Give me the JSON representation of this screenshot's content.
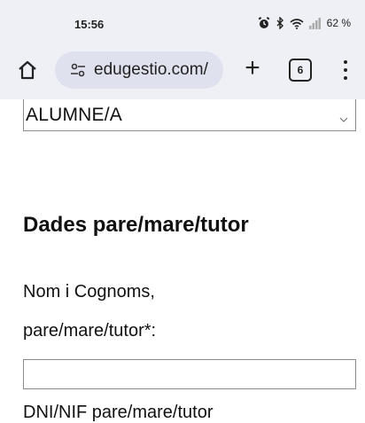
{
  "status_bar": {
    "time": "15:56",
    "battery": "62 %",
    "icons": [
      "alarm-icon",
      "bluetooth-icon",
      "wifi-icon",
      "signal-icon"
    ]
  },
  "browser": {
    "url": "edugestio.com/",
    "tab_count": "6",
    "new_tab_label": "+"
  },
  "form": {
    "role_select": {
      "selected": "ALUMNE/A"
    },
    "section_title": "Dades pare/mare/tutor",
    "name_field": {
      "label_line1": "Nom i Cognoms,",
      "label_line2": "pare/mare/tutor*:",
      "value": ""
    },
    "next_label": "DNI/NIF pare/mare/tutor"
  }
}
